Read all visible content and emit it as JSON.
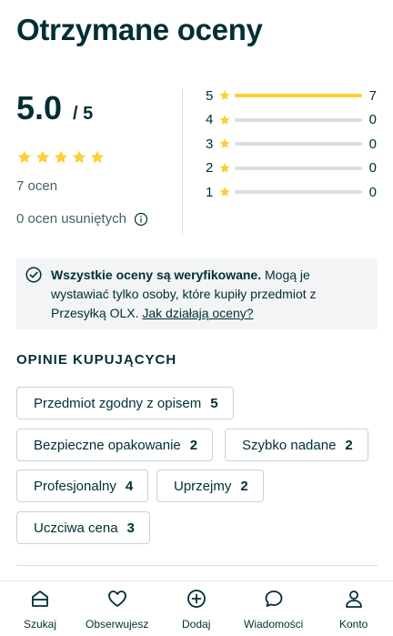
{
  "header": {
    "title": "Otrzymane oceny"
  },
  "summary": {
    "score": "5.0",
    "score_max": "/ 5",
    "stars": 5,
    "count_text": "7 ocen",
    "removed_text": "0 ocen usuniętych"
  },
  "distribution": [
    {
      "star": "5",
      "count": "7",
      "fraction": 1.0
    },
    {
      "star": "4",
      "count": "0",
      "fraction": 0.0
    },
    {
      "star": "3",
      "count": "0",
      "fraction": 0.0
    },
    {
      "star": "2",
      "count": "0",
      "fraction": 0.0
    },
    {
      "star": "1",
      "count": "0",
      "fraction": 0.0
    }
  ],
  "notice": {
    "bold": "Wszystkie oceny są weryfikowane.",
    "text": " Mogą je wystawiać tylko osoby, które kupiły przedmiot z Przesyłką OLX. ",
    "link": "Jak działają oceny?"
  },
  "buyer_opinions": {
    "title": "OPINIE KUPUJĄCYCH",
    "chips": [
      {
        "label": "Przedmiot zgodny z opisem",
        "count": "5"
      },
      {
        "label": "Bezpieczne opakowanie",
        "count": "2"
      },
      {
        "label": "Szybko nadane",
        "count": "2"
      },
      {
        "label": "Profesjonalny",
        "count": "4"
      },
      {
        "label": "Uprzejmy",
        "count": "2"
      },
      {
        "label": "Uczciwa cena",
        "count": "3"
      }
    ]
  },
  "nav": {
    "items": [
      {
        "label": "Szukaj",
        "icon": "home-icon"
      },
      {
        "label": "Obserwujesz",
        "icon": "heart-icon"
      },
      {
        "label": "Dodaj",
        "icon": "add-circle-icon"
      },
      {
        "label": "Wiadomości",
        "icon": "chat-icon"
      },
      {
        "label": "Konto",
        "icon": "user-icon"
      }
    ]
  },
  "colors": {
    "star": "#ffce32",
    "text": "#002f34",
    "muted": "#406367",
    "notice_bg": "#f2f4f5"
  }
}
